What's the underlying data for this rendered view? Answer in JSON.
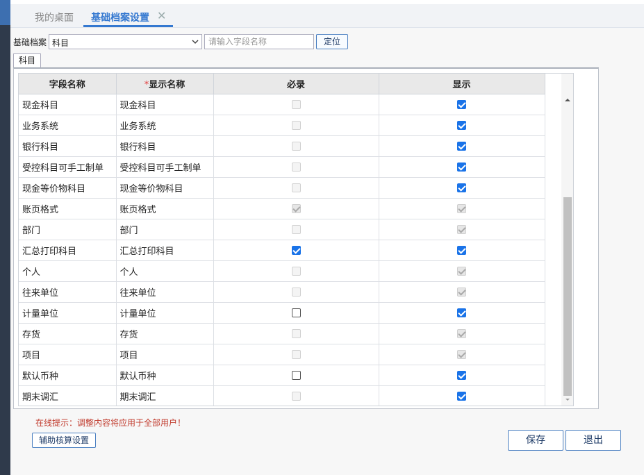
{
  "tabs": [
    {
      "label": "我的桌面",
      "active": false
    },
    {
      "label": "基础档案设置",
      "active": true
    }
  ],
  "tab_close_glyph": "✕",
  "filter": {
    "label": "基础档案",
    "selected": "科目",
    "search_placeholder": "请输入字段名称",
    "locate_label": "定位"
  },
  "subtab": "科目",
  "table": {
    "headers": {
      "field_name": "字段名称",
      "display_required_star": "*",
      "display_name": "显示名称",
      "required": "必录",
      "show": "显示"
    },
    "rows": [
      {
        "field": "现金科目",
        "display": "现金科目",
        "required": "dis-unchecked",
        "show": "checked"
      },
      {
        "field": "业务系统",
        "display": "业务系统",
        "required": "dis-unchecked",
        "show": "checked"
      },
      {
        "field": "银行科目",
        "display": "银行科目",
        "required": "dis-unchecked",
        "show": "checked"
      },
      {
        "field": "受控科目可手工制单",
        "display": "受控科目可手工制单",
        "required": "dis-unchecked",
        "show": "checked"
      },
      {
        "field": "现金等价物科目",
        "display": "现金等价物科目",
        "required": "dis-unchecked",
        "show": "checked"
      },
      {
        "field": "账页格式",
        "display": "账页格式",
        "required": "dis-checked",
        "show": "dis-checked"
      },
      {
        "field": "部门",
        "display": "部门",
        "required": "dis-unchecked",
        "show": "dis-checked"
      },
      {
        "field": "汇总打印科目",
        "display": "汇总打印科目",
        "required": "checked",
        "show": "checked"
      },
      {
        "field": "个人",
        "display": "个人",
        "required": "dis-unchecked",
        "show": "dis-checked"
      },
      {
        "field": "往来单位",
        "display": "往来单位",
        "required": "dis-unchecked",
        "show": "dis-checked"
      },
      {
        "field": "计量单位",
        "display": "计量单位",
        "required": "unchecked",
        "show": "checked"
      },
      {
        "field": "存货",
        "display": "存货",
        "required": "dis-unchecked",
        "show": "dis-checked"
      },
      {
        "field": "项目",
        "display": "项目",
        "required": "dis-unchecked",
        "show": "dis-checked"
      },
      {
        "field": "默认币种",
        "display": "默认币种",
        "required": "unchecked",
        "show": "checked"
      },
      {
        "field": "期末调汇",
        "display": "期末调汇",
        "required": "dis-unchecked",
        "show": "checked"
      }
    ]
  },
  "hint": "在线提示：调整内容将应用于全部用户！",
  "buttons": {
    "aux": "辅助核算设置",
    "save": "保存",
    "exit": "退出"
  },
  "colors": {
    "accent": "#3478d0",
    "checkbox": "#1a73e8",
    "hint": "#c0392b"
  }
}
